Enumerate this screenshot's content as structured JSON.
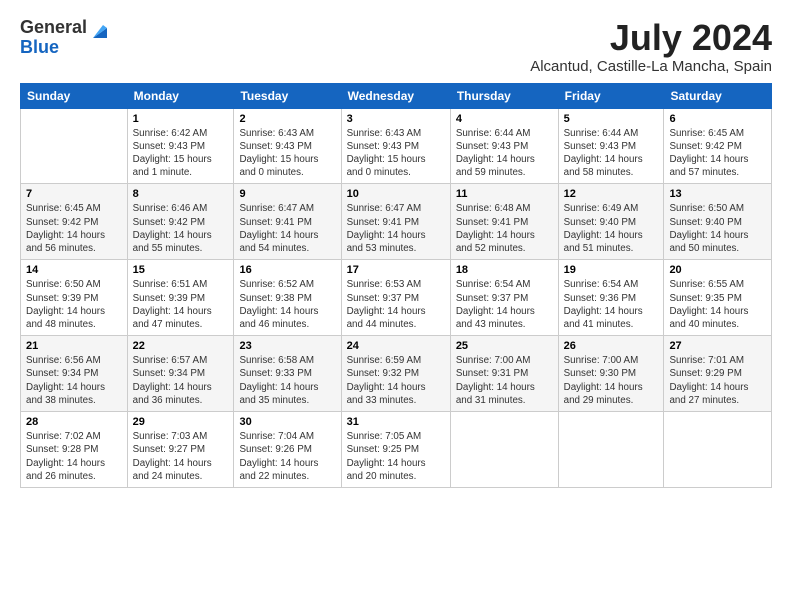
{
  "logo": {
    "general": "General",
    "blue": "Blue"
  },
  "title": "July 2024",
  "location": "Alcantud, Castille-La Mancha, Spain",
  "days_of_week": [
    "Sunday",
    "Monday",
    "Tuesday",
    "Wednesday",
    "Thursday",
    "Friday",
    "Saturday"
  ],
  "weeks": [
    [
      {
        "day": "",
        "info": ""
      },
      {
        "day": "1",
        "info": "Sunrise: 6:42 AM\nSunset: 9:43 PM\nDaylight: 15 hours\nand 1 minute."
      },
      {
        "day": "2",
        "info": "Sunrise: 6:43 AM\nSunset: 9:43 PM\nDaylight: 15 hours\nand 0 minutes."
      },
      {
        "day": "3",
        "info": "Sunrise: 6:43 AM\nSunset: 9:43 PM\nDaylight: 15 hours\nand 0 minutes."
      },
      {
        "day": "4",
        "info": "Sunrise: 6:44 AM\nSunset: 9:43 PM\nDaylight: 14 hours\nand 59 minutes."
      },
      {
        "day": "5",
        "info": "Sunrise: 6:44 AM\nSunset: 9:43 PM\nDaylight: 14 hours\nand 58 minutes."
      },
      {
        "day": "6",
        "info": "Sunrise: 6:45 AM\nSunset: 9:42 PM\nDaylight: 14 hours\nand 57 minutes."
      }
    ],
    [
      {
        "day": "7",
        "info": "Sunrise: 6:45 AM\nSunset: 9:42 PM\nDaylight: 14 hours\nand 56 minutes."
      },
      {
        "day": "8",
        "info": "Sunrise: 6:46 AM\nSunset: 9:42 PM\nDaylight: 14 hours\nand 55 minutes."
      },
      {
        "day": "9",
        "info": "Sunrise: 6:47 AM\nSunset: 9:41 PM\nDaylight: 14 hours\nand 54 minutes."
      },
      {
        "day": "10",
        "info": "Sunrise: 6:47 AM\nSunset: 9:41 PM\nDaylight: 14 hours\nand 53 minutes."
      },
      {
        "day": "11",
        "info": "Sunrise: 6:48 AM\nSunset: 9:41 PM\nDaylight: 14 hours\nand 52 minutes."
      },
      {
        "day": "12",
        "info": "Sunrise: 6:49 AM\nSunset: 9:40 PM\nDaylight: 14 hours\nand 51 minutes."
      },
      {
        "day": "13",
        "info": "Sunrise: 6:50 AM\nSunset: 9:40 PM\nDaylight: 14 hours\nand 50 minutes."
      }
    ],
    [
      {
        "day": "14",
        "info": "Sunrise: 6:50 AM\nSunset: 9:39 PM\nDaylight: 14 hours\nand 48 minutes."
      },
      {
        "day": "15",
        "info": "Sunrise: 6:51 AM\nSunset: 9:39 PM\nDaylight: 14 hours\nand 47 minutes."
      },
      {
        "day": "16",
        "info": "Sunrise: 6:52 AM\nSunset: 9:38 PM\nDaylight: 14 hours\nand 46 minutes."
      },
      {
        "day": "17",
        "info": "Sunrise: 6:53 AM\nSunset: 9:37 PM\nDaylight: 14 hours\nand 44 minutes."
      },
      {
        "day": "18",
        "info": "Sunrise: 6:54 AM\nSunset: 9:37 PM\nDaylight: 14 hours\nand 43 minutes."
      },
      {
        "day": "19",
        "info": "Sunrise: 6:54 AM\nSunset: 9:36 PM\nDaylight: 14 hours\nand 41 minutes."
      },
      {
        "day": "20",
        "info": "Sunrise: 6:55 AM\nSunset: 9:35 PM\nDaylight: 14 hours\nand 40 minutes."
      }
    ],
    [
      {
        "day": "21",
        "info": "Sunrise: 6:56 AM\nSunset: 9:34 PM\nDaylight: 14 hours\nand 38 minutes."
      },
      {
        "day": "22",
        "info": "Sunrise: 6:57 AM\nSunset: 9:34 PM\nDaylight: 14 hours\nand 36 minutes."
      },
      {
        "day": "23",
        "info": "Sunrise: 6:58 AM\nSunset: 9:33 PM\nDaylight: 14 hours\nand 35 minutes."
      },
      {
        "day": "24",
        "info": "Sunrise: 6:59 AM\nSunset: 9:32 PM\nDaylight: 14 hours\nand 33 minutes."
      },
      {
        "day": "25",
        "info": "Sunrise: 7:00 AM\nSunset: 9:31 PM\nDaylight: 14 hours\nand 31 minutes."
      },
      {
        "day": "26",
        "info": "Sunrise: 7:00 AM\nSunset: 9:30 PM\nDaylight: 14 hours\nand 29 minutes."
      },
      {
        "day": "27",
        "info": "Sunrise: 7:01 AM\nSunset: 9:29 PM\nDaylight: 14 hours\nand 27 minutes."
      }
    ],
    [
      {
        "day": "28",
        "info": "Sunrise: 7:02 AM\nSunset: 9:28 PM\nDaylight: 14 hours\nand 26 minutes."
      },
      {
        "day": "29",
        "info": "Sunrise: 7:03 AM\nSunset: 9:27 PM\nDaylight: 14 hours\nand 24 minutes."
      },
      {
        "day": "30",
        "info": "Sunrise: 7:04 AM\nSunset: 9:26 PM\nDaylight: 14 hours\nand 22 minutes."
      },
      {
        "day": "31",
        "info": "Sunrise: 7:05 AM\nSunset: 9:25 PM\nDaylight: 14 hours\nand 20 minutes."
      },
      {
        "day": "",
        "info": ""
      },
      {
        "day": "",
        "info": ""
      },
      {
        "day": "",
        "info": ""
      }
    ]
  ]
}
